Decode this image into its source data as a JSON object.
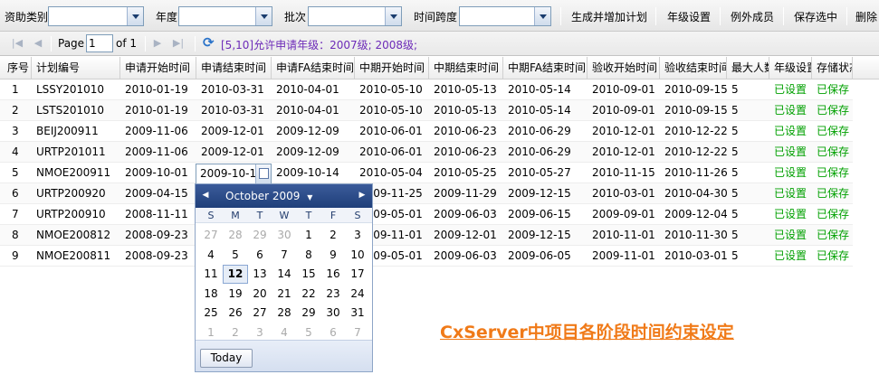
{
  "toolbar": {
    "funding_type_label": "资助类别",
    "grade_label": "年度",
    "batch_label": "批次",
    "time_span_label": "时间跨度",
    "funding_type_value": "",
    "grade_value": "",
    "batch_value": "",
    "time_span_value": "",
    "btn_generate": "生成并增加计划",
    "btn_grade_settings": "年级设置",
    "btn_exception_members": "例外成员",
    "btn_save_selected": "保存选中",
    "btn_delete": "删除"
  },
  "pager": {
    "page_label": "Page",
    "page_value": "1",
    "of_label": "of 1",
    "info": "[5,10]允许申请年级：2007级; 2008级;"
  },
  "grid": {
    "columns": [
      "序号",
      "计划编号",
      "申请开始时间",
      "申请结束时间",
      "申请FA结束时间",
      "中期开始时间",
      "中期结束时间",
      "中期FA结束时间",
      "验收开始时间",
      "验收结束时间",
      "最大人数",
      "年级设置",
      "存储状态"
    ],
    "rows": [
      [
        "1",
        "LSSY201010",
        "2010-01-19",
        "2010-03-31",
        "2010-04-01",
        "2010-05-10",
        "2010-05-13",
        "2010-05-14",
        "2010-09-01",
        "2010-09-15",
        "5",
        "已设置",
        "已保存"
      ],
      [
        "2",
        "LSTS201010",
        "2010-01-19",
        "2010-03-31",
        "2010-04-01",
        "2010-05-10",
        "2010-05-13",
        "2010-05-14",
        "2010-09-01",
        "2010-09-15",
        "5",
        "已设置",
        "已保存"
      ],
      [
        "3",
        "BEIJ200911",
        "2009-11-06",
        "2009-12-01",
        "2009-12-09",
        "2010-06-01",
        "2010-06-23",
        "2010-06-29",
        "2010-12-01",
        "2010-12-22",
        "5",
        "已设置",
        "已保存"
      ],
      [
        "4",
        "URTP201011",
        "2009-11-06",
        "2009-12-01",
        "2009-12-09",
        "2010-06-01",
        "2010-06-23",
        "2010-06-29",
        "2010-12-01",
        "2010-12-22",
        "5",
        "已设置",
        "已保存"
      ],
      [
        "5",
        "NMOE200911",
        "2009-10-01",
        "",
        "2009-10-14",
        "2010-05-04",
        "2010-05-25",
        "2010-05-27",
        "2010-11-15",
        "2010-11-26",
        "5",
        "已设置",
        "已保存"
      ],
      [
        "6",
        "URTP200920",
        "2009-04-15",
        "",
        "",
        "2009-11-25",
        "2009-11-29",
        "2009-12-15",
        "2010-03-01",
        "2010-04-30",
        "5",
        "已设置",
        "已保存"
      ],
      [
        "7",
        "URTP200910",
        "2008-11-11",
        "",
        "",
        "2009-05-01",
        "2009-06-03",
        "2009-06-15",
        "2009-09-01",
        "2009-12-04",
        "5",
        "已设置",
        "已保存"
      ],
      [
        "8",
        "NMOE200812",
        "2008-09-23",
        "",
        "",
        "2009-11-01",
        "2009-12-01",
        "2009-12-15",
        "2010-11-01",
        "2010-11-30",
        "5",
        "已设置",
        "已保存"
      ],
      [
        "9",
        "NMOE200811",
        "2008-09-23",
        "",
        "",
        "2009-05-01",
        "2009-06-03",
        "2009-06-05",
        "2009-11-01",
        "2010-03-01",
        "5",
        "已设置",
        "已保存"
      ]
    ],
    "editor_value": "2009-10-1"
  },
  "datepicker": {
    "month_label": "October 2009",
    "day_names": [
      "S",
      "M",
      "T",
      "W",
      "T",
      "F",
      "S"
    ],
    "weeks": [
      [
        "27",
        "28",
        "29",
        "30",
        "1",
        "2",
        "3"
      ],
      [
        "4",
        "5",
        "6",
        "7",
        "8",
        "9",
        "10"
      ],
      [
        "11",
        "12",
        "13",
        "14",
        "15",
        "16",
        "17"
      ],
      [
        "18",
        "19",
        "20",
        "21",
        "22",
        "23",
        "24"
      ],
      [
        "25",
        "26",
        "27",
        "28",
        "29",
        "30",
        "31"
      ],
      [
        "1",
        "2",
        "3",
        "4",
        "5",
        "6",
        "7"
      ]
    ],
    "selected_day": "12",
    "today_label": "Today"
  },
  "caption": "CxServer中项目各阶段时间约束设定"
}
